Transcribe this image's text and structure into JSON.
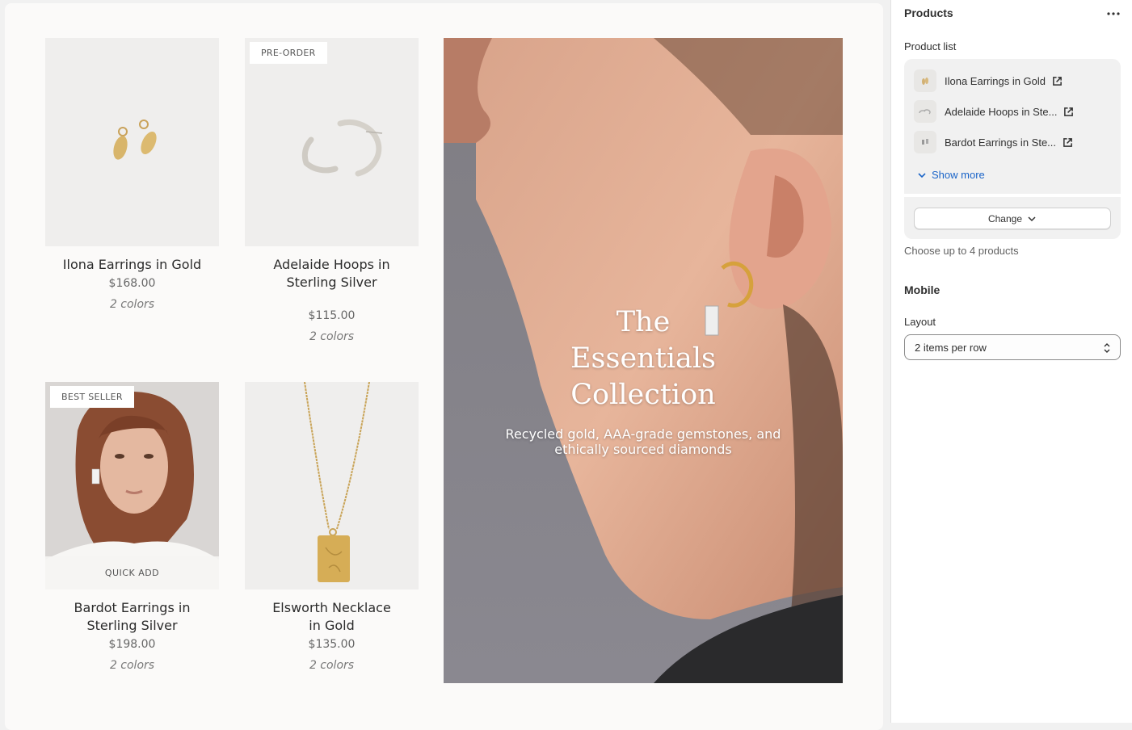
{
  "products": [
    {
      "title": "Ilona Earrings in Gold",
      "price": "$168.00",
      "colors": "2 colors",
      "badge": ""
    },
    {
      "title": "Adelaide Hoops in Sterling Silver",
      "price": "$115.00",
      "colors": "2 colors",
      "badge": "PRE-ORDER"
    },
    {
      "title": "Bardot Earrings in Sterling Silver",
      "price": "$198.00",
      "colors": "2 colors",
      "badge": "BEST SELLER",
      "quick_add": "QUICK ADD"
    },
    {
      "title": "Elsworth Necklace in Gold",
      "price": "$135.00",
      "colors": "2 colors",
      "badge": ""
    }
  ],
  "hero": {
    "title": "The Essentials Collection",
    "subtitle": "Recycled gold, AAA-grade gemstones, and ethically sourced diamonds"
  },
  "panel": {
    "title": "Products",
    "more_icon": "ellipsis-icon",
    "product_list_label": "Product list",
    "product_list": [
      {
        "name": "Ilona Earrings in Gold"
      },
      {
        "name": "Adelaide Hoops in Ste..."
      },
      {
        "name": "Bardot Earrings in Ste..."
      }
    ],
    "show_more": "Show more",
    "change_button": "Change",
    "hint": "Choose up to 4 products",
    "mobile_title": "Mobile",
    "layout_label": "Layout",
    "layout_value": "2 items per row"
  },
  "colors": {
    "link": "#1a64c8",
    "canvas_bg": "#fbfaf9",
    "panel_bg": "#ffffff"
  }
}
